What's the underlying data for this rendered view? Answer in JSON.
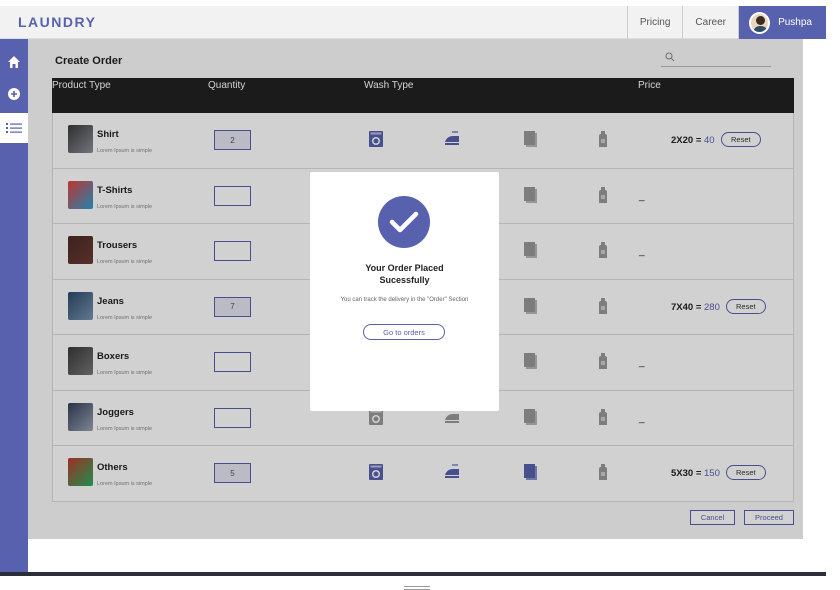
{
  "app": {
    "brand": "LAUNDRY"
  },
  "topnav": {
    "pricing": "Pricing",
    "career": "Career",
    "user_name": "Pushpa"
  },
  "sidebar": {
    "items": [
      {
        "icon": "home-icon"
      },
      {
        "icon": "add-circle-icon"
      },
      {
        "icon": "list-icon",
        "active": true
      }
    ]
  },
  "page": {
    "title": "Create Order",
    "search_placeholder": ""
  },
  "table": {
    "headers": {
      "product": "Product Type",
      "quantity": "Quantity",
      "wash": "Wash Type",
      "price": "Price"
    },
    "rows": [
      {
        "name": "Shirt",
        "desc": "Lorem Ipsum is simple",
        "qty": "2",
        "price_expr": "2X20 = ",
        "price_total": "40",
        "reset": "Reset"
      },
      {
        "name": "T-Shirts",
        "desc": "Lorem Ipsum is simple",
        "qty": "",
        "dash": "_"
      },
      {
        "name": "Trousers",
        "desc": "Lorem Ipsum is simple",
        "qty": "",
        "dash": "_"
      },
      {
        "name": "Jeans",
        "desc": "Lorem Ipsum is simple",
        "qty": "7",
        "price_expr": "7X40 = ",
        "price_total": "280",
        "reset": "Reset"
      },
      {
        "name": "Boxers",
        "desc": "Lorem Ipsum is simple",
        "qty": "",
        "dash": "_"
      },
      {
        "name": "Joggers",
        "desc": "Lorem Ipsum is simple",
        "qty": "",
        "dash": "_"
      },
      {
        "name": "Others",
        "desc": "Lorem Ipsum is simple",
        "qty": "5",
        "price_expr": "5X30 = ",
        "price_total": "150",
        "reset": "Reset"
      }
    ]
  },
  "actions": {
    "cancel": "Cancel",
    "proceed": "Proceed"
  },
  "modal": {
    "title": "Your Order Placed Sucessfully",
    "subtitle": "You can track the delivery in the \"Order\" Section",
    "button": "Go to orders"
  },
  "colors": {
    "accent": "#5861AE",
    "header": "#222222"
  }
}
